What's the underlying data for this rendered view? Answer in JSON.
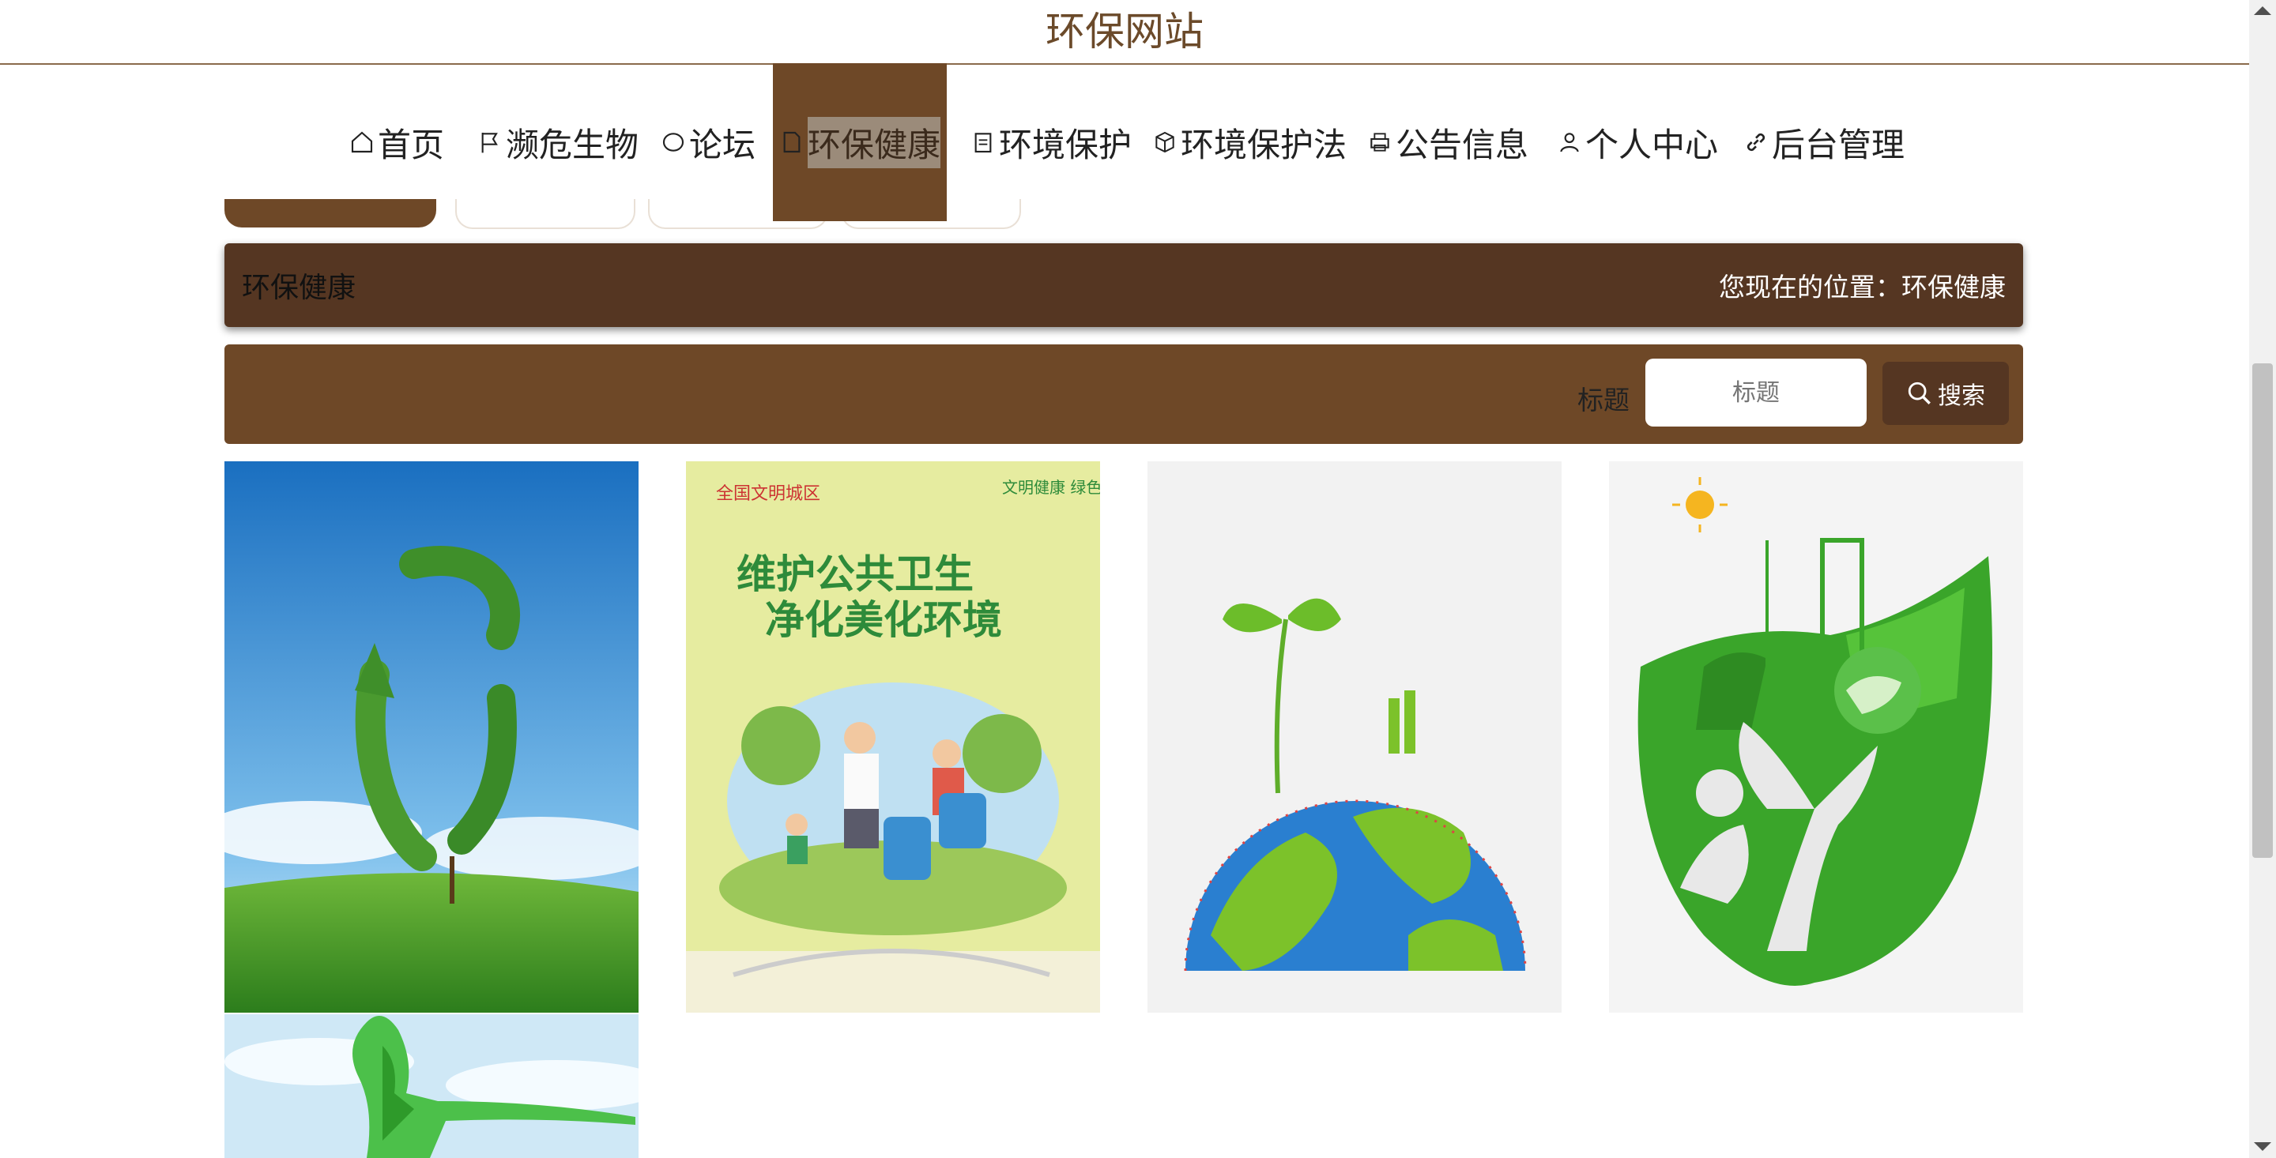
{
  "site": {
    "title": "环保网站"
  },
  "nav": {
    "items": [
      {
        "label": "首页",
        "icon": "home-icon"
      },
      {
        "label": "濒危生物",
        "icon": "flag-icon"
      },
      {
        "label": "论坛",
        "icon": "chat-icon"
      },
      {
        "label": "环保健康",
        "icon": "document-icon",
        "active": true
      },
      {
        "label": "环境保护",
        "icon": "clipboard-icon"
      },
      {
        "label": "环境保护法",
        "icon": "cube-icon"
      },
      {
        "label": "公告信息",
        "icon": "printer-icon"
      },
      {
        "label": "个人中心",
        "icon": "user-icon"
      },
      {
        "label": "后台管理",
        "icon": "link-icon"
      }
    ]
  },
  "breadcrumb": {
    "section": "环保健康",
    "location": "您现在的位置：环保健康"
  },
  "search": {
    "label": "标题",
    "placeholder": "标题",
    "button": "搜索"
  },
  "poster": {
    "corner_left": "全国文明城区",
    "corner_right": "文明健康 绿色环保",
    "line1": "维护公共卫生",
    "line2": "净化美化环境"
  },
  "colors": {
    "brown_dark": "#553622",
    "brown": "#6e4827",
    "title": "#6b4a2a"
  }
}
